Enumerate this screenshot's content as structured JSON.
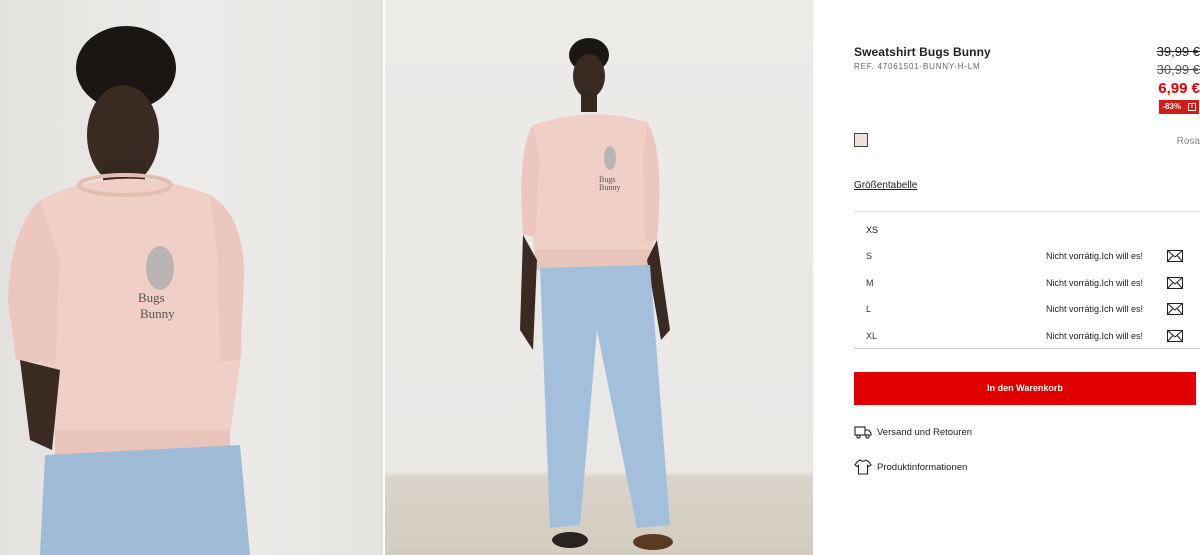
{
  "product": {
    "title": "Sweatshirt Bugs Bunny",
    "reference": "REF. 47061501-BUNNY-H-LM"
  },
  "price": {
    "original": "39,99 €",
    "previous": "30,99 €",
    "current": "6,99 €",
    "discount": "-83%",
    "discount_info": "i"
  },
  "color": {
    "name": "Rosa",
    "swatch": "#f0e0dc"
  },
  "size_guide_label": "Größentabelle",
  "sizes": [
    {
      "label": "XS",
      "status": ""
    },
    {
      "label": "S",
      "status": "Nicht vorrätig.Ich will es!"
    },
    {
      "label": "M",
      "status": "Nicht vorrätig.Ich will es!"
    },
    {
      "label": "L",
      "status": "Nicht vorrätig.Ich will es!"
    },
    {
      "label": "XL",
      "status": "Nicht vorrätig.Ich will es!"
    }
  ],
  "add_to_cart_label": "In den Warenkorb",
  "links": {
    "shipping": "Versand und Retouren",
    "product_info": "Produktinformationen"
  },
  "icons": {
    "notify": "mail-icon",
    "shipping": "truck-icon",
    "product_info": "tshirt-icon"
  },
  "colors": {
    "accent": "#e00000",
    "badge": "#d21a1a"
  }
}
